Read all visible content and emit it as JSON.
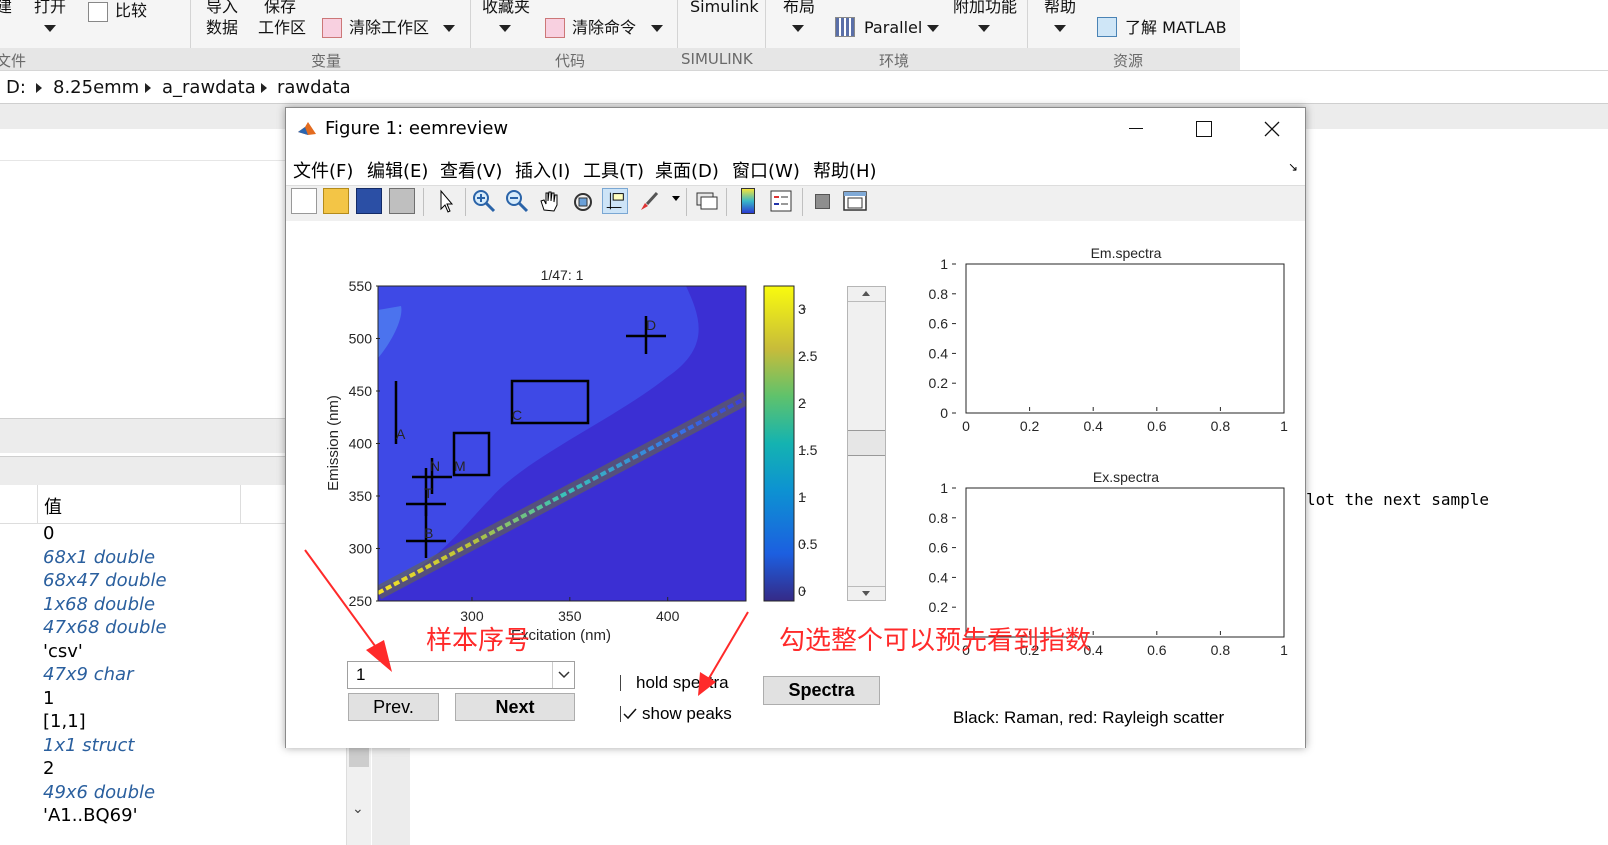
{
  "ribbon": {
    "top_labels": [
      "建",
      "打开",
      "比较",
      "导入",
      "保存",
      "收藏夹",
      "Simulink",
      "布局",
      "附加功能",
      "帮助"
    ],
    "second_labels": [
      "数据",
      "工作区"
    ],
    "clear_workspace": "清除工作区",
    "clear_commands": "清除命令",
    "parallel": "Parallel",
    "learn_matlab": "了解 MATLAB",
    "groups": [
      "文件",
      "变量",
      "代码",
      "SIMULINK",
      "环境",
      "资源"
    ]
  },
  "pathbar": {
    "crumbs": [
      "D:",
      "8.25emm",
      "a_rawdata",
      "rawdata"
    ]
  },
  "workspace": {
    "header_value": "值",
    "values": [
      {
        "text": "0",
        "italic": false
      },
      {
        "text": "68x1 double",
        "italic": true
      },
      {
        "text": "68x47 double",
        "italic": true
      },
      {
        "text": "1x68 double",
        "italic": true
      },
      {
        "text": "47x68 double",
        "italic": true
      },
      {
        "text": "'csv'",
        "italic": false
      },
      {
        "text": "47x9 char",
        "italic": true
      },
      {
        "text": "1",
        "italic": false
      },
      {
        "text": "[1,1]",
        "italic": false
      },
      {
        "text": "1x1 struct",
        "italic": true
      },
      {
        "text": "2",
        "italic": false
      },
      {
        "text": "49x6 double",
        "italic": true
      },
      {
        "text": "'A1..BQ69'",
        "italic": false
      }
    ]
  },
  "command_window": {
    "visible_text": "lot the next sample"
  },
  "figure": {
    "title": "Figure 1: eemreview",
    "menus": [
      "文件(F)",
      "编辑(E)",
      "查看(V)",
      "插入(I)",
      "工具(T)",
      "桌面(D)",
      "窗口(W)",
      "帮助(H)"
    ],
    "toolbar_icons": [
      "new-figure-icon",
      "open-file-icon",
      "save-icon",
      "print-icon",
      "pointer-icon",
      "zoom-in-icon",
      "zoom-out-icon",
      "pan-icon",
      "rotate-3d-icon",
      "data-cursor-icon",
      "brush-icon",
      "link-plot-icon",
      "colorbar-icon",
      "legend-icon",
      "hide-plot-tools-icon",
      "show-plot-tools-icon"
    ],
    "eem_plot": {
      "title": "1/47:  1",
      "xlabel": "Excitation (nm)",
      "ylabel": "Emission (nm)",
      "xticks": [
        "300",
        "350",
        "400"
      ],
      "yticks": [
        "250",
        "300",
        "350",
        "400",
        "450",
        "500",
        "550"
      ],
      "peaks": [
        "A",
        "B",
        "C",
        "D",
        "M",
        "N",
        "T"
      ]
    },
    "colorbar": {
      "ticks": [
        "0",
        "0.5",
        "1",
        "1.5",
        "2",
        "2.5",
        "3"
      ]
    },
    "em_axes": {
      "title": "Em.spectra",
      "xticks": [
        "0",
        "0.2",
        "0.4",
        "0.6",
        "0.8",
        "1"
      ],
      "yticks": [
        "0",
        "0.2",
        "0.4",
        "0.6",
        "0.8",
        "1"
      ]
    },
    "ex_axes": {
      "title": "Ex.spectra",
      "xticks": [
        "0",
        "0.2",
        "0.4",
        "0.6",
        "0.8",
        "1"
      ],
      "yticks": [
        "0.2",
        "0.4",
        "0.6",
        "0.8",
        "1"
      ]
    },
    "sample_select": "1",
    "prev_label": "Prev.",
    "next_label": "Next",
    "hold_spectra_label": "hold spectra",
    "hold_spectra_checked": false,
    "show_peaks_label": "show peaks",
    "show_peaks_checked": true,
    "spectra_label": "Spectra",
    "scatter_note": "Black: Raman, red: Rayleigh scatter"
  },
  "annotations": {
    "sample_index": "样本序号",
    "preview_hint": "勾选整个可以预先看到指数"
  },
  "colors": {
    "eem_background": "#3b2fd3",
    "eem_region": "#3e49e6",
    "annotation_red": "#ff2a2a"
  }
}
